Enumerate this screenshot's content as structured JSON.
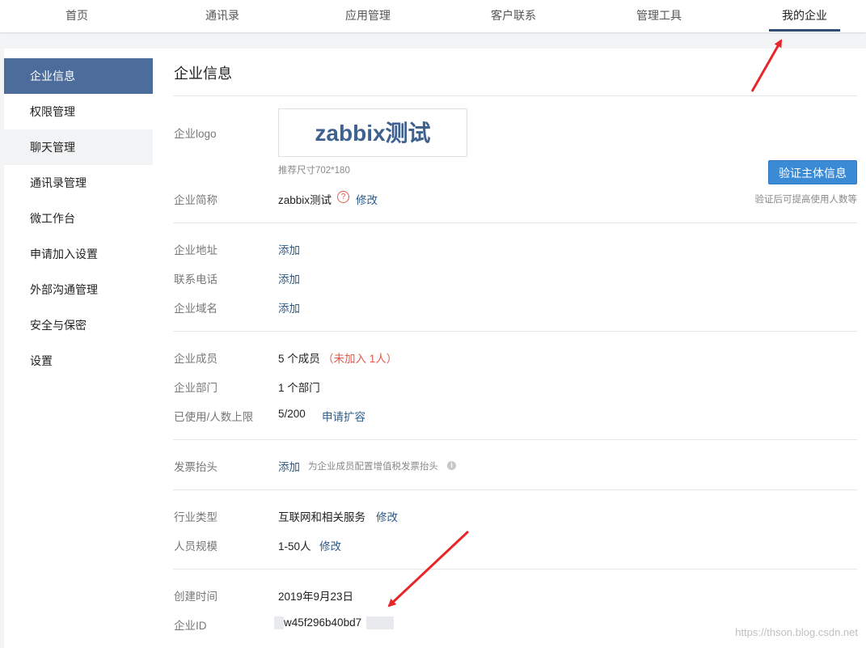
{
  "nav": {
    "items": [
      {
        "label": "首页"
      },
      {
        "label": "通讯录"
      },
      {
        "label": "应用管理"
      },
      {
        "label": "客户联系"
      },
      {
        "label": "管理工具"
      },
      {
        "label": "我的企业"
      }
    ],
    "active_index": 5
  },
  "sidebar": {
    "items": [
      {
        "label": "企业信息"
      },
      {
        "label": "权限管理"
      },
      {
        "label": "聊天管理"
      },
      {
        "label": "通讯录管理"
      },
      {
        "label": "微工作台"
      },
      {
        "label": "申请加入设置"
      },
      {
        "label": "外部沟通管理"
      },
      {
        "label": "安全与保密"
      },
      {
        "label": "设置"
      }
    ]
  },
  "main": {
    "title": "企业信息",
    "logo": {
      "label": "企业logo",
      "text": "zabbix测试",
      "hint": "推荐尺寸702*180"
    },
    "verify": {
      "button": "验证主体信息",
      "hint": "验证后可提高使用人数等"
    },
    "short_name": {
      "label": "企业简称",
      "value": "zabbix测试",
      "help_icon": "?",
      "edit": "修改"
    },
    "address": {
      "label": "企业地址",
      "action": "添加"
    },
    "phone": {
      "label": "联系电话",
      "action": "添加"
    },
    "domain": {
      "label": "企业域名",
      "action": "添加"
    },
    "members": {
      "label": "企业成员",
      "value": "5 个成员",
      "not_joined": "（未加入 1人）"
    },
    "departments": {
      "label": "企业部门",
      "value": "1 个部门"
    },
    "usage": {
      "label": "已使用/人数上限",
      "value": "5/200",
      "action": "申请扩容"
    },
    "invoice": {
      "label": "发票抬头",
      "action": "添加",
      "hint": "为企业成员配置增值税发票抬头",
      "info_icon": "i"
    },
    "industry": {
      "label": "行业类型",
      "value": "互联网和相关服务",
      "edit": "修改"
    },
    "scale": {
      "label": "人员规模",
      "value": "1-50人",
      "edit": "修改"
    },
    "created": {
      "label": "创建时间",
      "value": "2019年9月23日"
    },
    "corp_id": {
      "label": "企业ID",
      "value": "w45f296b40bd7"
    }
  },
  "watermark": "https://thson.blog.csdn.net",
  "colors": {
    "accent": "#4c6d9c",
    "link": "#2e5c8a",
    "button": "#3a8ad6",
    "warning": "#e05a4a",
    "annotation_arrow": "#e8262a"
  }
}
